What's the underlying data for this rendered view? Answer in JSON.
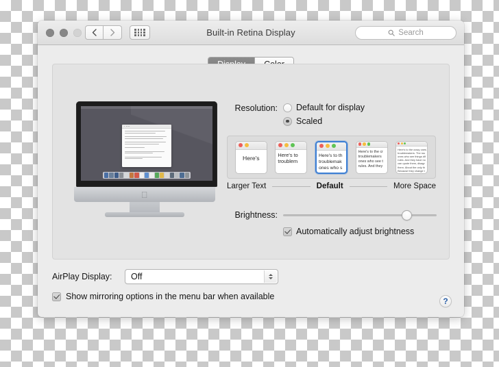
{
  "window": {
    "title": "Built-in Retina Display",
    "traffic_lights": [
      "close",
      "minimize",
      "zoom"
    ],
    "nav": {
      "back_label": "Back",
      "forward_label": "Forward",
      "grid_label": "Show All"
    },
    "search": {
      "placeholder": "Search",
      "value": "",
      "icon": "search-icon"
    }
  },
  "tabs": [
    {
      "label": "Display",
      "active": true
    },
    {
      "label": "Color",
      "active": false
    }
  ],
  "resolution": {
    "label": "Resolution:",
    "options": [
      {
        "label": "Default for display",
        "selected": false
      },
      {
        "label": "Scaled",
        "selected": true
      }
    ]
  },
  "scaled_thumbnails": {
    "items": [
      {
        "id": "larger-text",
        "selected": false,
        "lines": [
          "Here's"
        ]
      },
      {
        "id": "scaled-2",
        "selected": false,
        "lines": [
          "Here's to",
          "troublem"
        ]
      },
      {
        "id": "default",
        "selected": true,
        "lines": [
          "Here's to th",
          "troublemak",
          "ones who s"
        ]
      },
      {
        "id": "scaled-4",
        "selected": false,
        "lines": [
          "Here's to the cr",
          "troublemakers",
          "ones who see t",
          "rules. And they"
        ]
      },
      {
        "id": "more-space",
        "selected": false,
        "lines": [
          "Here's to the crazy ones",
          "troublemakers. The rou",
          "ones who see things dif",
          "rules. And they have no",
          "can quote them, disagr",
          "them. About the only th",
          "Because they change t"
        ]
      }
    ],
    "labels": {
      "left": "Larger Text",
      "center": "Default",
      "right": "More Space"
    }
  },
  "brightness": {
    "label": "Brightness:",
    "value_percent": 78,
    "auto_adjust": {
      "label": "Automatically adjust brightness",
      "checked": true
    }
  },
  "airplay": {
    "label": "AirPlay Display:",
    "selected": "Off",
    "options": [
      "Off"
    ]
  },
  "mirroring": {
    "label": "Show mirroring options in the menu bar when available",
    "checked": true
  },
  "help": {
    "label": "?"
  },
  "preview": {
    "device": "iMac",
    "apple_logo": "",
    "doc_line_count": 9
  }
}
